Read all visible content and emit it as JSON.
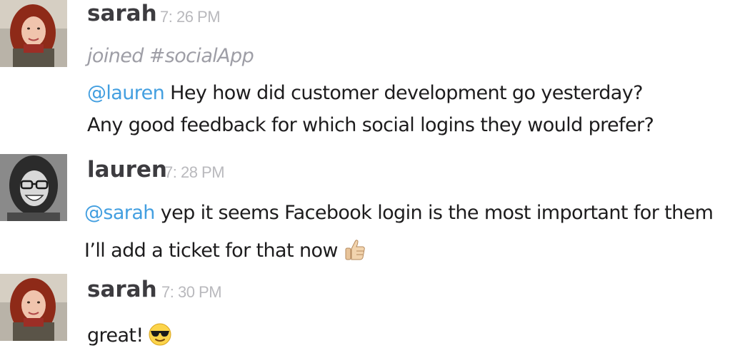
{
  "messages": [
    {
      "user": "sarah",
      "time": "7: 26 PM",
      "system_text": "joined #socialApp",
      "lines": [
        {
          "mention": "@lauren",
          "text": " Hey how did customer development go yesterday?"
        },
        {
          "mention": "",
          "text": "Any good feedback for which social logins they would prefer?"
        }
      ]
    },
    {
      "user": "lauren",
      "time": "7: 28 PM",
      "lines": [
        {
          "mention": "@sarah",
          "text": " yep it seems Facebook login is the most important for them"
        },
        {
          "mention": "",
          "text": "I’ll add a ticket for that now",
          "emoji": "thumbs-up-icon"
        }
      ]
    },
    {
      "user": "sarah",
      "time": "7: 30 PM",
      "lines": [
        {
          "mention": "",
          "text": "great!",
          "emoji": "sunglasses-face-icon"
        }
      ]
    }
  ]
}
